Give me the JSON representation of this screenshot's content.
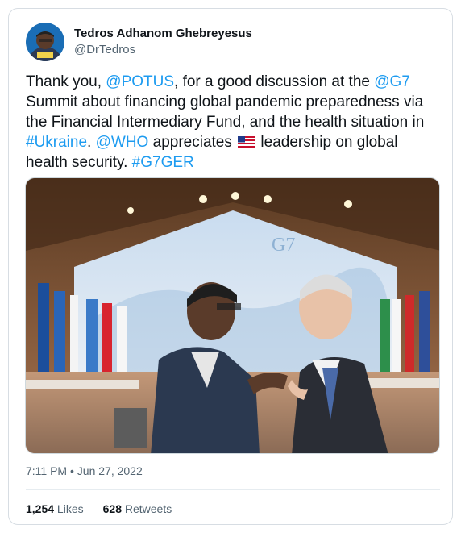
{
  "tweet": {
    "author": {
      "display_name": "Tedros Adhanom Ghebreyesus",
      "handle": "@DrTedros",
      "avatar": "avatar-photo"
    },
    "text": {
      "part1": "Thank you, ",
      "mention_potus": "@POTUS",
      "part2": ", for a good discussion at the ",
      "mention_g7": "@G7",
      "part3": " Summit about financing global pandemic preparedness via the Financial Intermediary Fund, and the health situation in ",
      "hashtag_ukraine": "#Ukraine",
      "part4": ". ",
      "mention_who": "@WHO",
      "part5": " appreciates ",
      "flag_emoji": "us-flag-icon",
      "part6": " leadership on global health security. ",
      "hashtag_g7ger": "#G7GER"
    },
    "media": {
      "type": "photo",
      "stage_logo": "G7"
    },
    "timestamp": "7:11 PM • Jun 27, 2022",
    "stats": {
      "likes_count": "1,254",
      "likes_label": " Likes",
      "retweets_count": "628",
      "retweets_label": " Retweets"
    }
  },
  "colors": {
    "link": "#1d9bf0",
    "text": "#0f1419",
    "muted": "#536471",
    "border": "#cfd9de"
  }
}
